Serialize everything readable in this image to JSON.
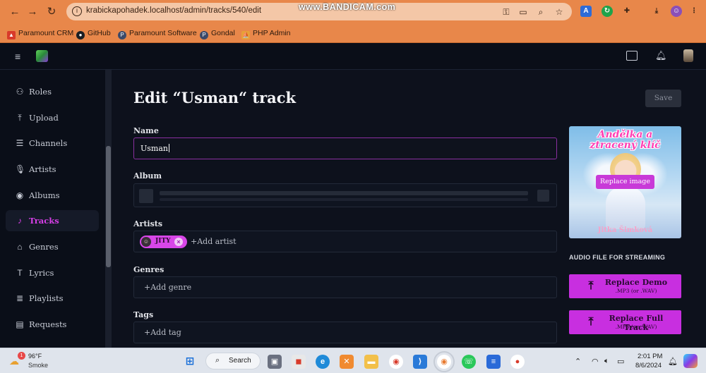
{
  "browser": {
    "url": "krabickapohadek.localhost/admin/tracks/540/edit",
    "watermark": "www.BANDICAM.com",
    "bookmarks": [
      "Paramount CRM",
      "GitHub",
      "Paramount Software",
      "Gondal",
      "PHP Admin"
    ]
  },
  "sidebar": {
    "items": [
      {
        "label": "Roles",
        "icon": "users-icon"
      },
      {
        "label": "Upload",
        "icon": "upload-icon"
      },
      {
        "label": "Channels",
        "icon": "playlist-icon"
      },
      {
        "label": "Artists",
        "icon": "microphone-icon"
      },
      {
        "label": "Albums",
        "icon": "disc-icon"
      },
      {
        "label": "Tracks",
        "icon": "music-note-icon"
      },
      {
        "label": "Genres",
        "icon": "tag-icon"
      },
      {
        "label": "Lyrics",
        "icon": "text-icon"
      },
      {
        "label": "Playlists",
        "icon": "playlist-add-icon"
      },
      {
        "label": "Requests",
        "icon": "document-icon"
      }
    ],
    "active": "Tracks"
  },
  "page": {
    "title": "Edit “Usman“ track",
    "save_label": "Save"
  },
  "form": {
    "name_label": "Name",
    "name_value": "Usman",
    "album_label": "Album",
    "artists_label": "Artists",
    "artist_chip": "JITY",
    "add_artist": "+Add artist",
    "genres_label": "Genres",
    "add_genre": "+Add genre",
    "tags_label": "Tags",
    "add_tag": "+Add tag"
  },
  "cover": {
    "title_line1": "Andělka a",
    "title_line2": "ztracený klíč",
    "author": "Jitka Šimková",
    "replace_label": "Replace image"
  },
  "audio": {
    "section_label": "AUDIO FILE FOR STREAMING",
    "demo_title": "Replace Demo",
    "demo_sub": ".MP3 (or .WAV)",
    "full_title": "Replace Full Track",
    "full_sub": ".MP3 (or .WAV)"
  },
  "taskbar": {
    "weather_temp": "96°F",
    "weather_desc": "Smoke",
    "weather_badge": "1",
    "search_label": "Search",
    "time": "2:01 PM",
    "date": "8/6/2024"
  },
  "colors": {
    "accent": "#d63fe6",
    "button": "#c82fe0",
    "browser_chrome": "#e8874a"
  }
}
